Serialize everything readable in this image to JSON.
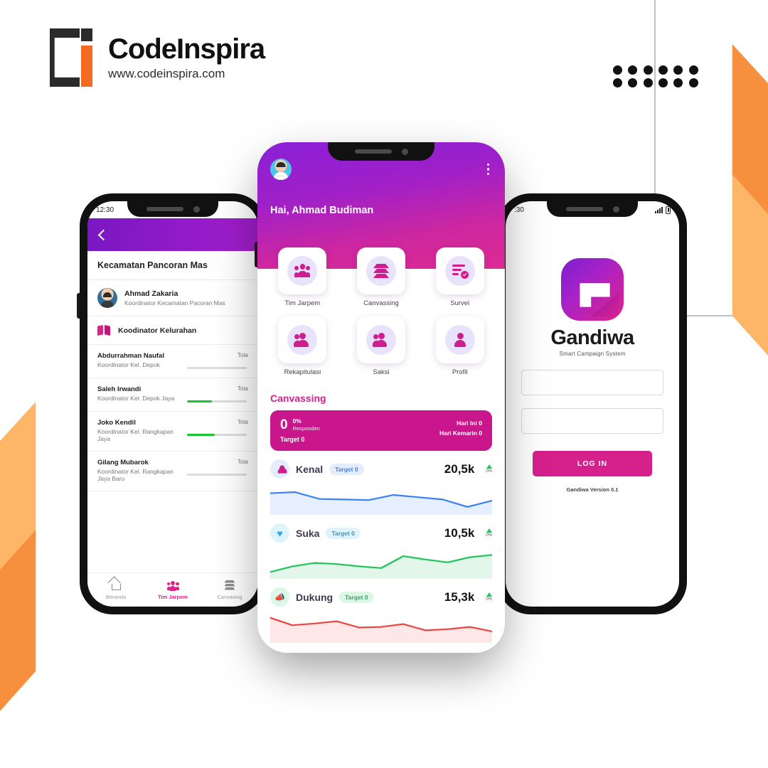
{
  "brand": {
    "name": "CodeInspira",
    "url": "www.codeinspira.com"
  },
  "colors": {
    "magenta": "#D6208C",
    "purple": "#8A1FD6",
    "orange_dark": "#F7903E",
    "orange_light": "#FDB567",
    "green": "#16C42F"
  },
  "left_phone": {
    "status": {
      "time": "12:30"
    },
    "appbar": {
      "back_icon": "chevron-left-icon"
    },
    "page_title": "Kecamatan Pancoran Mas",
    "coordinator": {
      "name": "Ahmad Zakaria",
      "role": "Koordinator Kecamatan Pacoran Mas"
    },
    "section": {
      "icon": "map-icon",
      "label": "Koodinator Kelurahan"
    },
    "kelurahan": [
      {
        "name": "Abdurrahman Naufal",
        "role": "Koordinator Kel. Depok",
        "total_label": "Tota",
        "progress": 0
      },
      {
        "name": "Saleh Irwandi",
        "role": "Koordinator Kel. Depok Jaya",
        "total_label": "Tota",
        "progress": 42
      },
      {
        "name": "Joko Kendil",
        "role": "Koordinator Kel. Rangkapan Jaya",
        "total_label": "Tota",
        "progress": 46
      },
      {
        "name": "Gilang Mubarok",
        "role": "Koordinator Kel. Rangkapan Jaya Baru",
        "total_label": "Tota",
        "progress": 0
      }
    ],
    "bottom_nav": [
      {
        "label": "Beranda",
        "icon": "home-icon",
        "active": false
      },
      {
        "label": "Tim Jarpem",
        "icon": "people-icon",
        "active": true
      },
      {
        "label": "Canvasing",
        "icon": "layers-icon",
        "active": false
      }
    ]
  },
  "center_phone": {
    "header": {
      "avatar": "user-avatar",
      "menu_icon": "kebab-menu-icon",
      "greeting": "Hai, Ahmad Budiman"
    },
    "menu": [
      {
        "label": "Tim Jarpem",
        "icon": "people-group-icon"
      },
      {
        "label": "Canvassing",
        "icon": "layers-icon"
      },
      {
        "label": "Survei",
        "icon": "checklist-icon"
      },
      {
        "label": "Rekapitulasi",
        "icon": "two-persons-icon"
      },
      {
        "label": "Saksi",
        "icon": "two-persons-icon"
      },
      {
        "label": "Profil",
        "icon": "person-icon"
      }
    ],
    "canvassing": {
      "title": "Canvassing",
      "card": {
        "big_value": "0",
        "percent": "0%",
        "percent_sub": "Responden",
        "target": "Target 0",
        "today": "Hari Ini 0",
        "yesterday": "Hari Kemarin 0"
      },
      "stats": [
        {
          "label": "Kenal",
          "chip": "Target 0",
          "value": "20,5k",
          "delta": "0%",
          "icon": "person-check-icon",
          "color": "#3B82F6",
          "icon_bg": "#E3EDFD",
          "chip_bg": "#E3EDFD",
          "chip_fg": "#4B7FD4"
        },
        {
          "label": "Suka",
          "chip": "Target 0",
          "value": "10,5k",
          "delta": "0%",
          "icon": "heart-icon",
          "color": "#22C55E",
          "icon_bg": "#DFF3FC",
          "chip_bg": "#DFF3FC",
          "chip_fg": "#4A8FB8"
        },
        {
          "label": "Dukung",
          "chip": "Target 0",
          "value": "15,3k",
          "delta": "0%",
          "icon": "megaphone-icon",
          "color": "#EF4444",
          "icon_bg": "#DDF7E6",
          "chip_bg": "#DDF7E6",
          "chip_fg": "#3F9B68"
        }
      ]
    }
  },
  "right_phone": {
    "status": {
      "time": ":30",
      "signal_icon": "signal-bars-icon",
      "battery_icon": "battery-icon"
    },
    "logo_name": "Gandiwa",
    "tagline": "Smart Campaign System",
    "fields": [
      {
        "name": "username",
        "value": "",
        "placeholder": ""
      },
      {
        "name": "password",
        "value": "",
        "placeholder": ""
      }
    ],
    "login_button": "LOG IN",
    "version": "Gandiwa Version 0.1"
  },
  "chart_data": [
    {
      "type": "area",
      "title": "Kenal",
      "color": "#3B82F6",
      "x": [
        1,
        2,
        3,
        4,
        5,
        6,
        7,
        8,
        9,
        10
      ],
      "values": [
        66,
        70,
        46,
        44,
        42,
        60,
        52,
        44,
        18,
        40
      ],
      "ylim": [
        0,
        100
      ],
      "ylabel": "",
      "xlabel": "",
      "grid": false,
      "legend": "none",
      "total": "20,5k",
      "delta": "0%"
    },
    {
      "type": "area",
      "title": "Suka",
      "color": "#22C55E",
      "x": [
        1,
        2,
        3,
        4,
        5,
        6,
        7,
        8,
        9,
        10
      ],
      "values": [
        14,
        34,
        46,
        42,
        34,
        28,
        70,
        58,
        48,
        66,
        74
      ],
      "ylim": [
        0,
        100
      ],
      "ylabel": "",
      "xlabel": "",
      "grid": false,
      "legend": "none",
      "total": "10,5k",
      "delta": "0%"
    },
    {
      "type": "area",
      "title": "Dukung",
      "color": "#EF4444",
      "x": [
        1,
        2,
        3,
        4,
        5,
        6,
        7,
        8,
        9,
        10
      ],
      "values": [
        78,
        52,
        58,
        66,
        44,
        46,
        56,
        34,
        38,
        46,
        30
      ],
      "ylim": [
        0,
        100
      ],
      "ylabel": "",
      "xlabel": "",
      "grid": false,
      "legend": "none",
      "total": "15,3k",
      "delta": "0%"
    }
  ]
}
